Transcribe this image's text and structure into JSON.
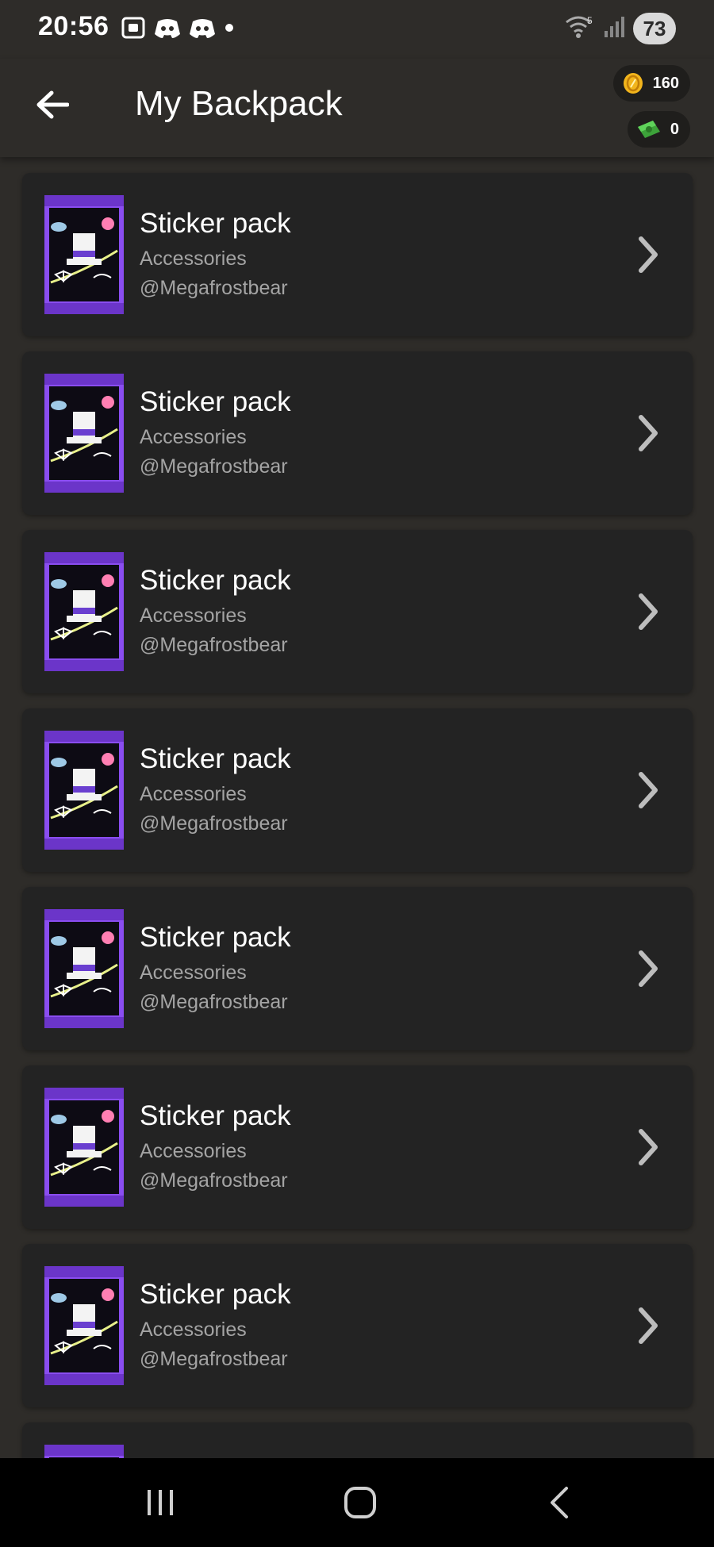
{
  "status_bar": {
    "time": "20:56",
    "battery": "73",
    "signal_label": "5"
  },
  "header": {
    "title": "My Backpack",
    "coins": "160",
    "cash": "0"
  },
  "items": [
    {
      "title": "Sticker pack",
      "category": "Accessories",
      "author": "@Megafrostbear"
    },
    {
      "title": "Sticker pack",
      "category": "Accessories",
      "author": "@Megafrostbear"
    },
    {
      "title": "Sticker pack",
      "category": "Accessories",
      "author": "@Megafrostbear"
    },
    {
      "title": "Sticker pack",
      "category": "Accessories",
      "author": "@Megafrostbear"
    },
    {
      "title": "Sticker pack",
      "category": "Accessories",
      "author": "@Megafrostbear"
    },
    {
      "title": "Sticker pack",
      "category": "Accessories",
      "author": "@Megafrostbear"
    },
    {
      "title": "Sticker pack",
      "category": "Accessories",
      "author": "@Megafrostbear"
    },
    {
      "title": "",
      "category": "",
      "author": ""
    }
  ],
  "icons": {
    "back": "arrow-left-icon",
    "coin": "coin-icon",
    "cash": "cash-icon",
    "chevron": "chevron-right-icon",
    "nav_recents": "recents-icon",
    "nav_home": "home-icon",
    "nav_back": "back-icon"
  },
  "colors": {
    "background": "#2e2c29",
    "card": "#232323",
    "pack_purple": "#8a4df0",
    "secondary_text": "#a4a4a4"
  }
}
